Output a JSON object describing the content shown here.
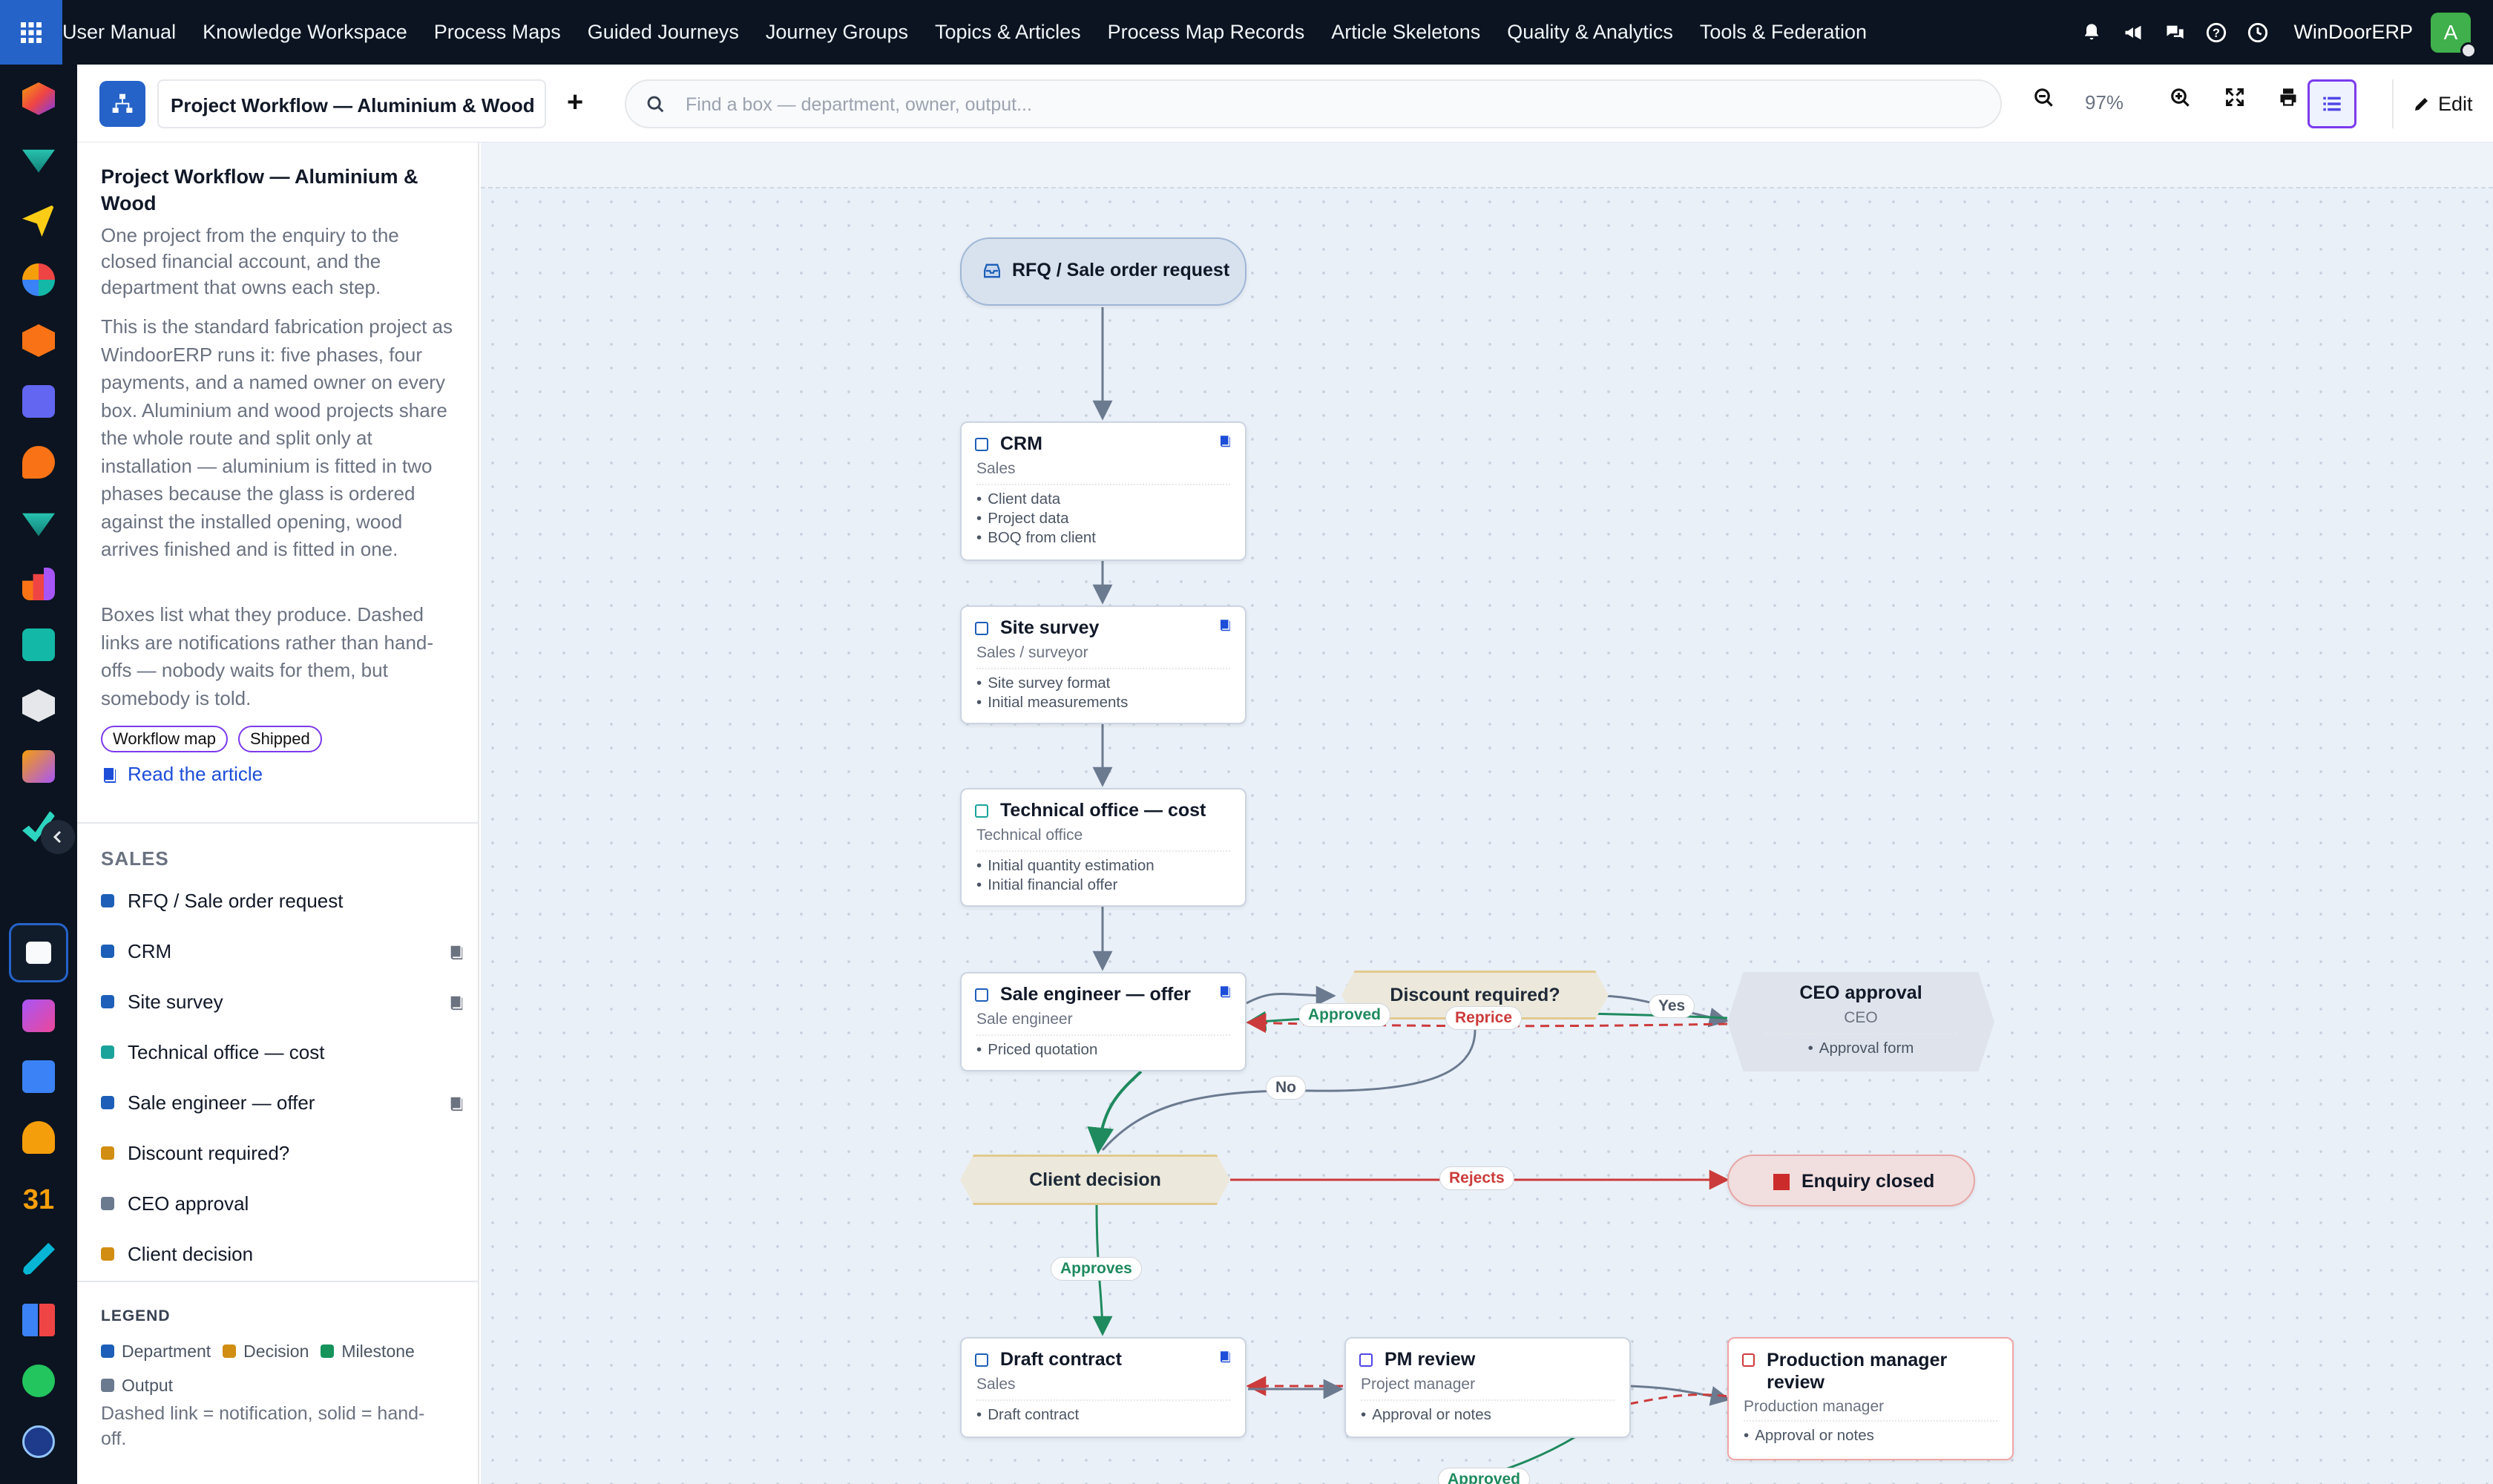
{
  "topbar": {
    "nav": [
      "User Manual",
      "Knowledge Workspace",
      "Process Maps",
      "Guided Journeys",
      "Journey Groups",
      "Topics & Articles",
      "Process Map Records",
      "Article Skeletons",
      "Quality & Analytics",
      "Tools & Federation"
    ],
    "brand": "WinDoorERP",
    "user_initial": "A"
  },
  "toolbar": {
    "map_title": "Project Workflow — Aluminium & Wood",
    "search_placeholder": "Find a box — department, owner, output...",
    "zoom": "97%",
    "edit_label": "Edit"
  },
  "panel": {
    "title": "Project Workflow — Aluminium & Wood",
    "subtitle": "One project from the enquiry to the closed financial account, and the department that owns each step.",
    "description": "This is the standard fabrication project as WindoorERP runs it: five phases, four payments, and a named owner on every box. Aluminium and wood projects share the whole route and split only at installation — aluminium is fitted in two phases because the glass is ordered against the installed opening, wood arrives finished and is fitted in one.",
    "description2": "Boxes list what they produce. Dashed links are notifications rather than hand-offs — nobody waits for them, but somebody is told.",
    "tags": [
      "Workflow map",
      "Shipped"
    ],
    "article_link": "Read the article",
    "section": "SALES",
    "items": [
      {
        "label": "RFQ / Sale order request",
        "color": "#1d5fb8",
        "book": false
      },
      {
        "label": "CRM",
        "color": "#1d5fb8",
        "book": true
      },
      {
        "label": "Site survey",
        "color": "#1d5fb8",
        "book": true
      },
      {
        "label": "Technical office — cost",
        "color": "#1aa39a",
        "book": false
      },
      {
        "label": "Sale engineer — offer",
        "color": "#1d5fb8",
        "book": true
      },
      {
        "label": "Discount required?",
        "color": "#d18e12",
        "book": false
      },
      {
        "label": "CEO approval",
        "color": "#6b7a8f",
        "book": false
      },
      {
        "label": "Client decision",
        "color": "#d18e12",
        "book": false
      }
    ],
    "legend": {
      "title": "LEGEND",
      "items": [
        {
          "label": "Department",
          "color": "#1d5fb8"
        },
        {
          "label": "Decision",
          "color": "#d18e12"
        },
        {
          "label": "Milestone",
          "color": "#15935b"
        },
        {
          "label": "Output",
          "color": "#6b7a8f"
        }
      ],
      "note": "Dashed link = notification, solid = hand-off."
    }
  },
  "canvas": {
    "start": {
      "label": "RFQ / Sale order request"
    },
    "crm": {
      "title": "CRM",
      "owner": "Sales",
      "outputs": [
        "Client data",
        "Project data",
        "BOQ from client"
      ]
    },
    "survey": {
      "title": "Site survey",
      "owner": "Sales / surveyor",
      "outputs": [
        "Site survey format",
        "Initial measurements"
      ]
    },
    "tech": {
      "title": "Technical office — cost",
      "owner": "Technical office",
      "outputs": [
        "Initial quantity estimation",
        "Initial financial offer"
      ]
    },
    "offer": {
      "title": "Sale engineer — offer",
      "owner": "Sale engineer",
      "outputs": [
        "Priced quotation"
      ]
    },
    "discount": {
      "label": "Discount required?"
    },
    "ceo": {
      "title": "CEO approval",
      "owner": "CEO",
      "outputs": [
        "Approval form"
      ]
    },
    "client": {
      "label": "Client decision"
    },
    "closed": {
      "label": "Enquiry closed"
    },
    "contract": {
      "title": "Draft contract",
      "owner": "Sales",
      "outputs": [
        "Draft contract"
      ]
    },
    "pm": {
      "title": "PM review",
      "owner": "Project manager",
      "outputs": [
        "Approval or notes"
      ]
    },
    "prodmgr": {
      "title": "Production manager review",
      "owner": "Production manager",
      "outputs": [
        "Approval or notes"
      ]
    },
    "edge_labels": {
      "approved": "Approved",
      "reprice": "Reprice",
      "yes": "Yes",
      "no": "No",
      "rejects": "Rejects",
      "approves": "Approves",
      "approved2": "Approved"
    },
    "colors": {
      "handoff": "#6b7a8f",
      "approve": "#1f8a5e",
      "reject": "#cc3b3b"
    }
  }
}
